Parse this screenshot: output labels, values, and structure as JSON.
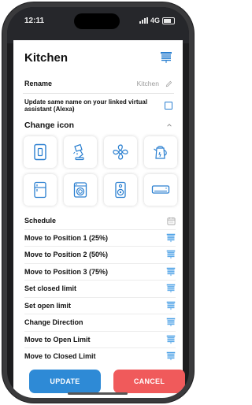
{
  "status": {
    "time": "12:11",
    "network": "4G"
  },
  "header": {
    "title": "Kitchen",
    "icon": "blind-icon"
  },
  "rename": {
    "label": "Rename",
    "value": "Kitchen",
    "icon": "pencil-icon"
  },
  "alexa": {
    "label": "Update same name on your linked virtual assistant (Alexa)",
    "checked": false
  },
  "change_icon": {
    "label": "Change icon",
    "expanded": true
  },
  "icons": [
    "switch-icon",
    "lamp-icon",
    "fan-icon",
    "kettle-icon",
    "fridge-icon",
    "washing-machine-icon",
    "speaker-icon",
    "air-conditioner-icon"
  ],
  "schedule": {
    "label": "Schedule",
    "icon": "calendar-icon"
  },
  "actions": [
    "Move to Position 1 (25%)",
    "Move to Position 2 (50%)",
    "Move to Position 3 (75%)",
    "Set closed limit",
    "Set open limit",
    "Change Direction",
    "Move to Open Limit",
    "Move to Closed Limit"
  ],
  "buttons": {
    "update": "UPDATE",
    "cancel": "CANCEL"
  },
  "colors": {
    "accent": "#2e8ad6",
    "cancel": "#f05a5b",
    "icon_blue": "#2a7fd0"
  }
}
